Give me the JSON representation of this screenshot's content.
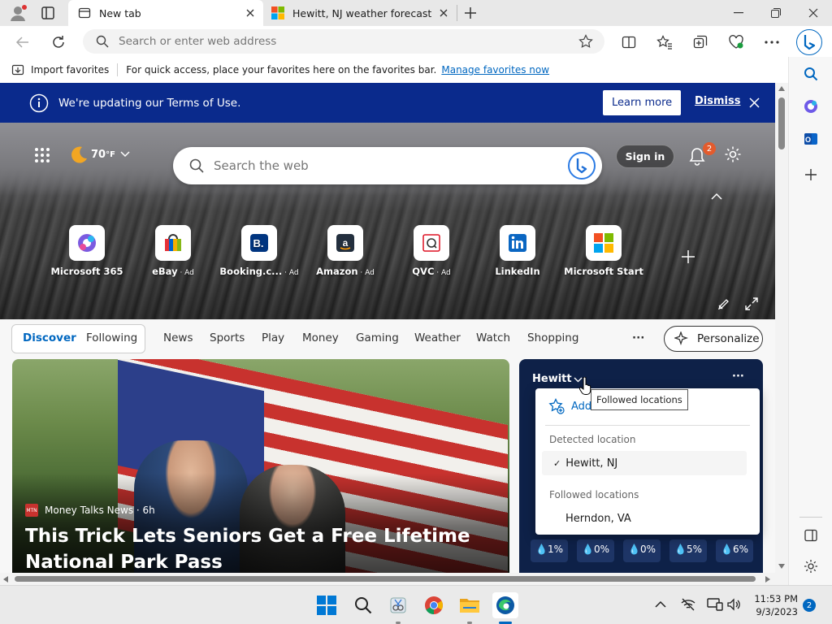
{
  "tabs": [
    {
      "title": "New tab",
      "active": true
    },
    {
      "title": "Hewitt, NJ weather forecast | Mic",
      "active": false
    }
  ],
  "address": {
    "placeholder": "Search or enter web address"
  },
  "favorites_bar": {
    "import_label": "Import favorites",
    "hint": "For quick access, place your favorites here on the favorites bar.",
    "manage_link": "Manage favorites now"
  },
  "banner": {
    "text": "We're updating our Terms of Use.",
    "learn_more": "Learn more",
    "dismiss": "Dismiss"
  },
  "hero": {
    "temperature": "70",
    "unit": "°F",
    "search_placeholder": "Search the web",
    "sign_in": "Sign in",
    "notification_count": "2"
  },
  "quick_links": [
    {
      "label": "Microsoft 365",
      "ad": ""
    },
    {
      "label": "eBay",
      "ad": " · Ad"
    },
    {
      "label": "Booking.c...",
      "ad": " · Ad"
    },
    {
      "label": "Amazon",
      "ad": " · Ad"
    },
    {
      "label": "QVC",
      "ad": " · Ad"
    },
    {
      "label": "LinkedIn",
      "ad": ""
    },
    {
      "label": "Microsoft Start",
      "ad": ""
    }
  ],
  "nav": {
    "discover": "Discover",
    "following": "Following",
    "items": [
      "News",
      "Sports",
      "Play",
      "Money",
      "Gaming",
      "Weather",
      "Watch",
      "Shopping"
    ],
    "more": "···",
    "personalize": "Personalize"
  },
  "main_story": {
    "source_badge": "MTN",
    "source": "Money Talks News · 6h",
    "headline": "This Trick Lets Seniors Get a Free Lifetime National Park Pass"
  },
  "weather": {
    "location": "Hewitt",
    "more": "···",
    "tooltip": "Followed locations",
    "add_location": "Add location",
    "detected_header": "Detected location",
    "detected_item": "Hewitt, NJ",
    "followed_header": "Followed locations",
    "followed_item": "Herndon, VA",
    "precip": [
      "1%",
      "0%",
      "0%",
      "5%",
      "6%"
    ]
  },
  "taskbar": {
    "time": "11:53 PM",
    "date": "9/3/2023",
    "notification_count": "2"
  },
  "colors": {
    "banner": "#0a2a8c",
    "accent": "#0067c0",
    "weather_card": "#0e2148"
  }
}
